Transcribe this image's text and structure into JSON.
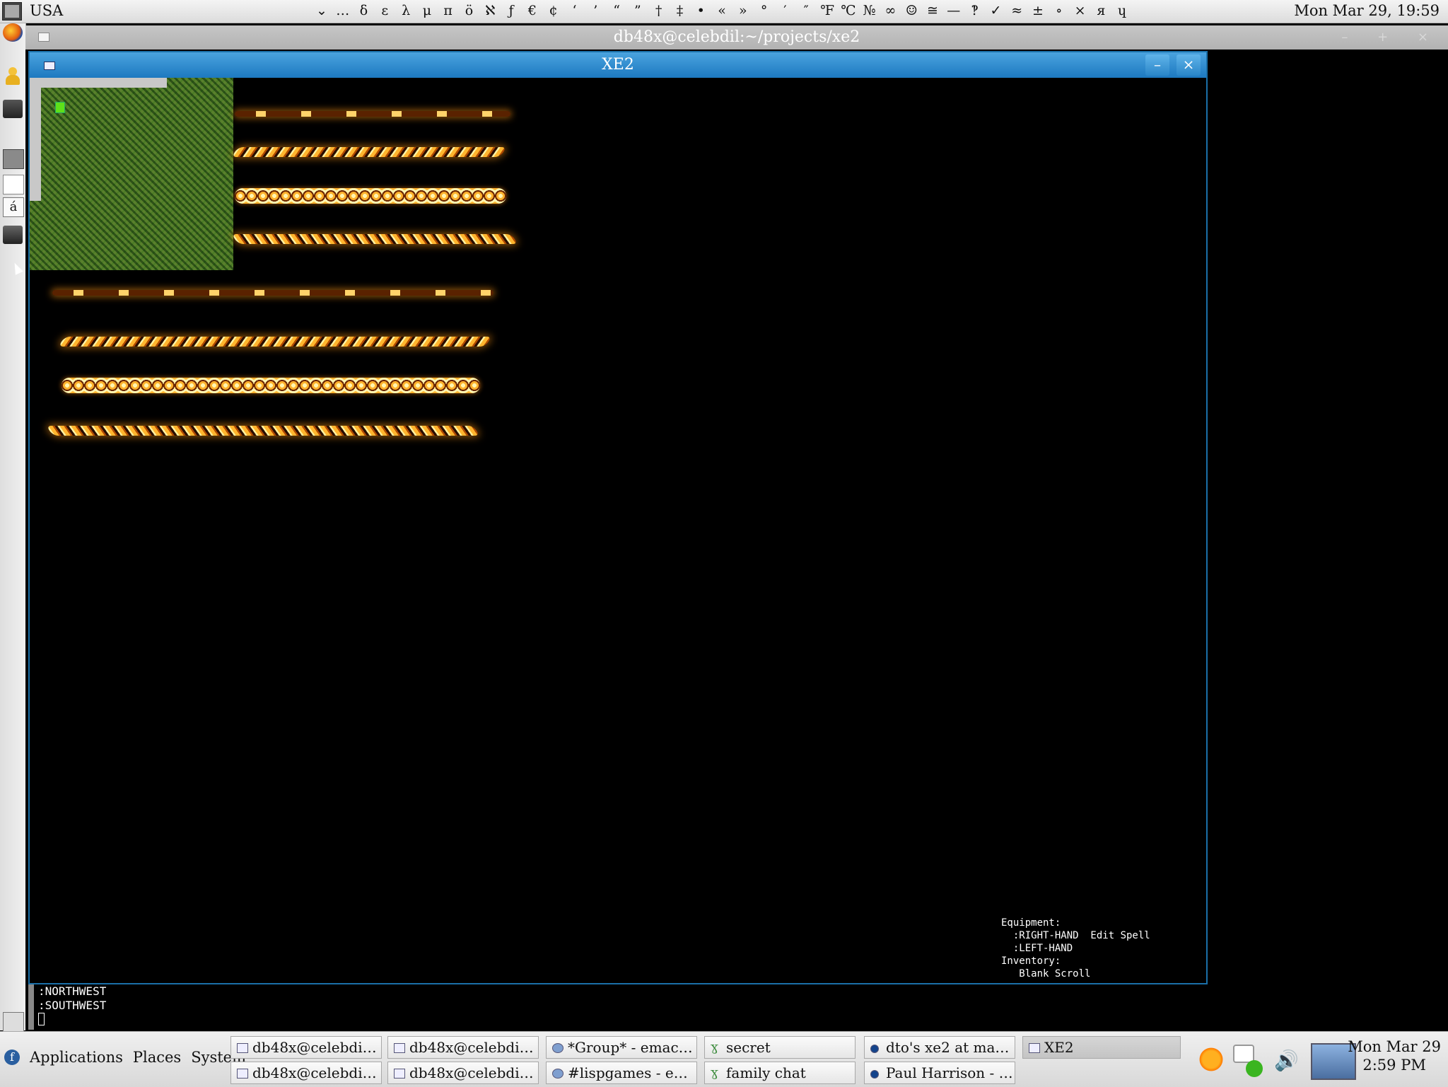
{
  "top_panel": {
    "layout": "USA",
    "chars": [
      "⌄",
      "…",
      "δ",
      "ε",
      "λ",
      "μ",
      "π",
      "ö",
      "ℵ",
      "ƒ",
      "€",
      "¢",
      "‘",
      "’",
      "“",
      "”",
      "†",
      "‡",
      "•",
      "«",
      "»",
      "°",
      "′",
      "″",
      "℉",
      "℃",
      "№",
      "∞",
      "☺",
      "≅",
      "—",
      "‽",
      "✓",
      "≈",
      "±",
      "∘",
      "×",
      "я",
      "ɥ"
    ],
    "clock": "Mon Mar 29, 19:59"
  },
  "launcher": {
    "char_map_glyph": "á"
  },
  "terminal": {
    "title": "db48x@celebdil:~/projects/xe2",
    "controls": "– + ×"
  },
  "xe2": {
    "title": "XE2",
    "minimize": "–",
    "close": "×",
    "hud": {
      "equipment_label": "Equipment:",
      "right_hand": "  :RIGHT-HAND  Edit Spell",
      "left_hand": "  :LEFT-HAND",
      "inventory_label": "Inventory:",
      "item1": "   Blank Scroll"
    }
  },
  "minibuffer": {
    "line1": ":NORTHWEST",
    "line2": ":SOUTHWEST"
  },
  "bottom_panel": {
    "fedora": "f",
    "menus": [
      "Applications",
      "Places",
      "System"
    ],
    "tasks_row1": [
      "db48x@celebdil:~...",
      "db48x@celebdil:~...",
      "*Group* - emacs...",
      "secret",
      "dto's xe2 at maste...",
      "XE2"
    ],
    "tasks_row2": [
      "db48x@celebdil:~",
      "db48x@celebdil:~",
      "#lispgames - ema...",
      "family chat",
      "Paul Harrison - M..."
    ],
    "clock_date": "Mon Mar 29",
    "clock_time": "2:59 PM"
  }
}
